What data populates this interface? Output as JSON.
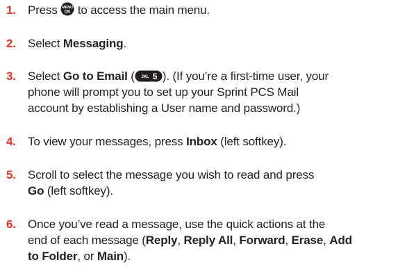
{
  "steps": [
    {
      "number": "1.",
      "before_key": "Press ",
      "key": {
        "label_top": "MENU",
        "label_bottom": "OK",
        "icon": "menu-ok-key-icon"
      },
      "after_key": " to access the main menu."
    },
    {
      "number": "2.",
      "before": "Select ",
      "bold": "Messaging",
      "after": "."
    },
    {
      "number": "3.",
      "before": "Select ",
      "bold": "Go to Email",
      "paren_open": " (",
      "key": {
        "letters": "JKL",
        "digit": "5",
        "icon": "jkl5-key-icon"
      },
      "paren_close": ").",
      "line1_tail": " (If you’re a first-time user, your",
      "line2": "phone will prompt you to set up your Sprint PCS Mail",
      "line3": "account by establishing a User name and password.)"
    },
    {
      "number": "4.",
      "before": "To view your messages, press ",
      "bold": "Inbox",
      "after": " (left softkey)."
    },
    {
      "number": "5.",
      "line1": "Scroll to select the message you wish to read and press",
      "bold": "Go",
      "after": " (left softkey)."
    },
    {
      "number": "6.",
      "line1": "Once you’ve read a message, use the quick actions at the",
      "line2_before": "end of each message (",
      "actions": [
        "Reply",
        "Reply All",
        "Forward",
        "Erase",
        "Add",
        "to Folder",
        "Main"
      ],
      "sep_comma": ", ",
      "sep_or": ", or ",
      "line3_end": ")."
    }
  ]
}
